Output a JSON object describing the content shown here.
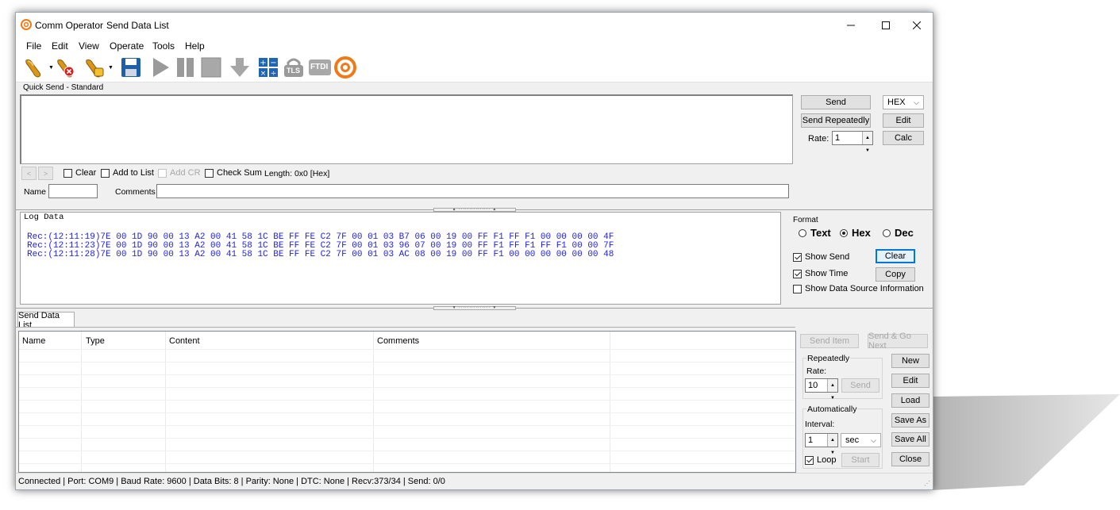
{
  "window": {
    "title": "Comm Operator",
    "subtitle": "Send Data List",
    "min_icon": "minimize-icon",
    "max_icon": "maximize-icon",
    "close_icon": "close-icon"
  },
  "menu": [
    "File",
    "Edit",
    "View",
    "Operate",
    "Tools",
    "Help"
  ],
  "toolbar": {
    "icons": [
      "connect-icon",
      "disconnect-icon",
      "connection-settings-icon",
      "save-icon",
      "start-icon",
      "pause-icon",
      "stop-icon",
      "download-icon",
      "calculator-icon",
      "tls-icon",
      "ftdi-icon",
      "app-logo-icon"
    ],
    "tls_label": "TLS",
    "ftdi_label": "FTDI"
  },
  "quick_send": {
    "group_label": "Quick Send - Standard",
    "clear_label": "Clear",
    "add_to_list_label": "Add to List",
    "add_cr_label": "Add CR",
    "check_sum_label": "Check Sum",
    "length_text": "Length: 0x0 [Hex]",
    "name_label": "Name",
    "comments_label": "Comments",
    "send_label": "Send",
    "format_value": "HEX",
    "send_repeatedly_label": "Send Repeatedly",
    "edit_label": "Edit",
    "rate_label": "Rate:",
    "rate_value": "1",
    "calc_label": "Calc"
  },
  "log": {
    "title": "Log Data",
    "lines": [
      "Rec:(12:11:19)7E 00 1D 90 00 13 A2 00 41 58 1C BE FF FE C2 7F 00 01 03 B7 06 00 19 00 FF F1 FF F1 00 00 00 00 4F",
      "Rec:(12:11:23)7E 00 1D 90 00 13 A2 00 41 58 1C BE FF FE C2 7F 00 01 03 96 07 00 19 00 FF F1 FF F1 FF F1 00 00 7F",
      "Rec:(12:11:28)7E 00 1D 90 00 13 A2 00 41 58 1C BE FF FE C2 7F 00 01 03 AC 08 00 19 00 FF F1 00 00 00 00 00 00 48"
    ],
    "format_label": "Format",
    "text_label": "Text",
    "hex_label": "Hex",
    "dec_label": "Dec",
    "show_send_label": "Show Send",
    "show_time_label": "Show Time",
    "show_source_label": "Show Data Source Information",
    "clear_label": "Clear",
    "copy_label": "Copy"
  },
  "send_list": {
    "tab_label": "Send Data List",
    "columns": [
      "Name",
      "Type",
      "Content",
      "Comments"
    ],
    "send_item_label": "Send Item",
    "send_go_next_label": "Send & Go Next",
    "repeatedly_label": "Repeatedly",
    "rate_label": "Rate:",
    "rate_value": "10",
    "send_label": "Send",
    "automatically_label": "Automatically",
    "interval_label": "Interval:",
    "interval_value": "1",
    "unit_value": "sec",
    "loop_label": "Loop",
    "start_label": "Start",
    "new_label": "New",
    "edit_label": "Edit",
    "load_label": "Load",
    "save_as_label": "Save As",
    "save_all_label": "Save All",
    "close_label": "Close"
  },
  "status": {
    "text": "Connected | Port: COM9 | Baud Rate: 9600 | Data Bits: 8 | Parity: None | DTC: None | Recv:373/34 | Send: 0/0"
  },
  "colors": {
    "log_text": "#1e1ee6",
    "accent": "#0078d7",
    "window_bg": "#f0f0f0"
  }
}
